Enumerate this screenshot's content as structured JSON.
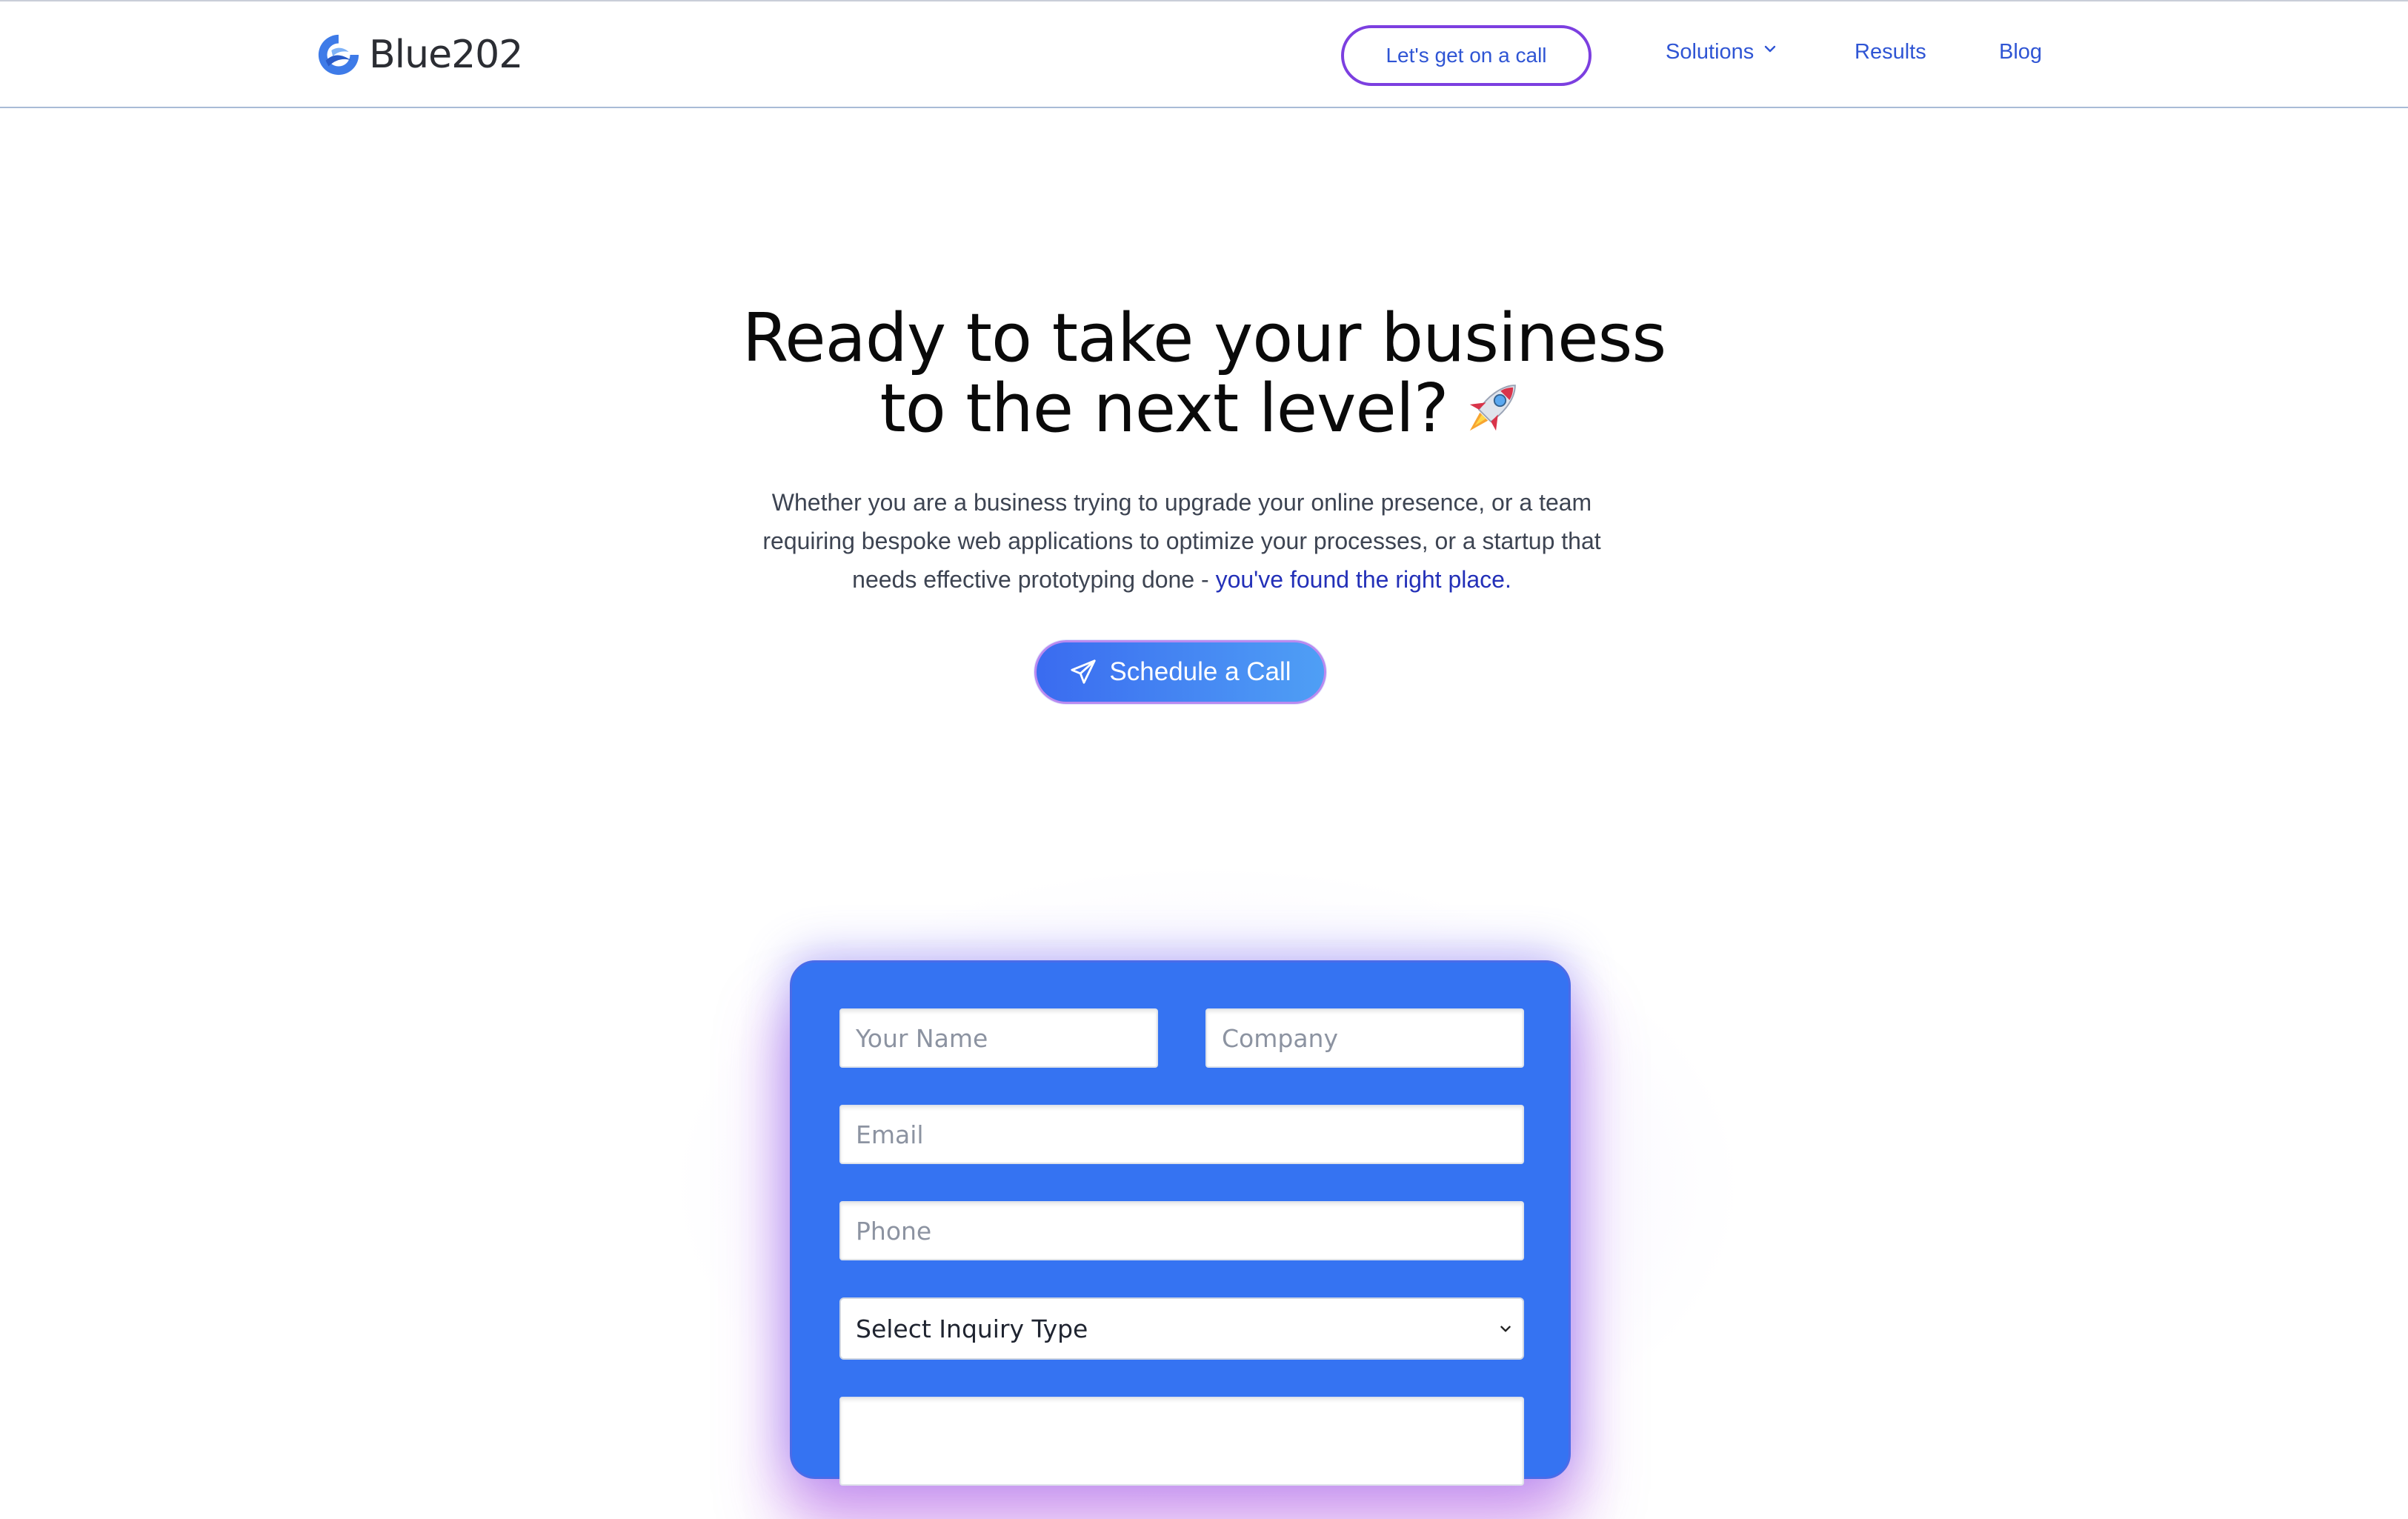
{
  "nav": {
    "brand": "Blue202",
    "cta_label": "Let's get on a call",
    "links": [
      {
        "label": "Solutions",
        "icon": "chevron-down-icon"
      },
      {
        "label": "Results"
      },
      {
        "label": "Blog"
      }
    ]
  },
  "hero": {
    "title_line1": "Ready to take your business",
    "title_line2": "to the next level?",
    "title_icon": "rocket-icon",
    "description": "Whether you are a business trying to upgrade your online presence, or a team requiring bespoke web applications to optimize your processes, or a startup that needs effective prototyping done - ",
    "description_highlight": "you've found the right place.",
    "button_label": "Schedule a Call",
    "button_icon": "paper-plane-icon"
  },
  "form": {
    "name_placeholder": "Your Name",
    "company_placeholder": "Company",
    "email_placeholder": "Email",
    "phone_placeholder": "Phone",
    "inquiry_select": "Select Inquiry Type",
    "message_placeholder": ""
  },
  "colors": {
    "accent": "#2f55d4",
    "form_background": "#3573f2",
    "cta_border": "#7c3fe0",
    "highlight_text": "#2330b8"
  }
}
